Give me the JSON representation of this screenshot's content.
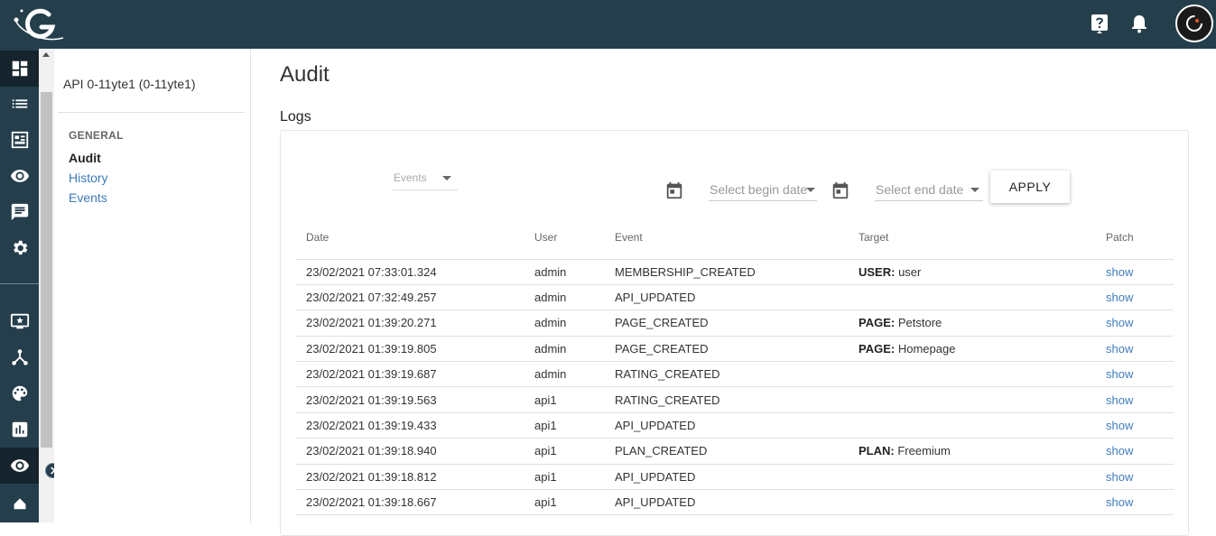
{
  "colors": {
    "header_bg": "#253e4c",
    "rail_active": "#15242d",
    "link": "#3f7bbd"
  },
  "header": {
    "logo_icon": "gravitee-logo-icon",
    "help_icon": "help-icon",
    "notifications_icon": "bell-icon",
    "avatar_icon": "user-avatar"
  },
  "rail": {
    "items": [
      {
        "icon": "dashboard-icon"
      },
      {
        "icon": "list-icon"
      },
      {
        "icon": "catalog-icon"
      },
      {
        "icon": "eye-icon"
      },
      {
        "icon": "message-icon"
      },
      {
        "icon": "gear-icon"
      },
      {
        "icon": "portal-icon"
      },
      {
        "icon": "hierarchy-icon"
      },
      {
        "icon": "palette-icon"
      },
      {
        "icon": "analytics-icon"
      },
      {
        "icon": "eye-icon"
      },
      {
        "icon": "home-icon"
      }
    ]
  },
  "subnav": {
    "api_name": "API 0-11yte1 (0-11yte1)",
    "section": "GENERAL",
    "links": [
      "Audit",
      "History",
      "Events"
    ]
  },
  "main": {
    "title": "Audit",
    "logs_title": "Logs",
    "filters": {
      "events_placeholder": "Events",
      "begin_date_placeholder": "Select begin date",
      "end_date_placeholder": "Select end date",
      "apply_label": "APPLY"
    },
    "table": {
      "headers": [
        "Date",
        "User",
        "Event",
        "Target",
        "Patch"
      ],
      "rows": [
        {
          "date": "23/02/2021 07:33:01.324",
          "user": "admin",
          "event": "MEMBERSHIP_CREATED",
          "target_key": "USER:",
          "target_value": "user",
          "patch": "show"
        },
        {
          "date": "23/02/2021 07:32:49.257",
          "user": "admin",
          "event": "API_UPDATED",
          "target_key": "",
          "target_value": "",
          "patch": "show"
        },
        {
          "date": "23/02/2021 01:39:20.271",
          "user": "admin",
          "event": "PAGE_CREATED",
          "target_key": "PAGE:",
          "target_value": "Petstore",
          "patch": "show"
        },
        {
          "date": "23/02/2021 01:39:19.805",
          "user": "admin",
          "event": "PAGE_CREATED",
          "target_key": "PAGE:",
          "target_value": "Homepage",
          "patch": "show"
        },
        {
          "date": "23/02/2021 01:39:19.687",
          "user": "admin",
          "event": "RATING_CREATED",
          "target_key": "",
          "target_value": "",
          "patch": "show"
        },
        {
          "date": "23/02/2021 01:39:19.563",
          "user": "api1",
          "event": "RATING_CREATED",
          "target_key": "",
          "target_value": "",
          "patch": "show"
        },
        {
          "date": "23/02/2021 01:39:19.433",
          "user": "api1",
          "event": "API_UPDATED",
          "target_key": "",
          "target_value": "",
          "patch": "show"
        },
        {
          "date": "23/02/2021 01:39:18.940",
          "user": "api1",
          "event": "PLAN_CREATED",
          "target_key": "PLAN:",
          "target_value": "Freemium",
          "patch": "show"
        },
        {
          "date": "23/02/2021 01:39:18.812",
          "user": "api1",
          "event": "API_UPDATED",
          "target_key": "",
          "target_value": "",
          "patch": "show"
        },
        {
          "date": "23/02/2021 01:39:18.667",
          "user": "api1",
          "event": "API_UPDATED",
          "target_key": "",
          "target_value": "",
          "patch": "show"
        }
      ]
    }
  }
}
